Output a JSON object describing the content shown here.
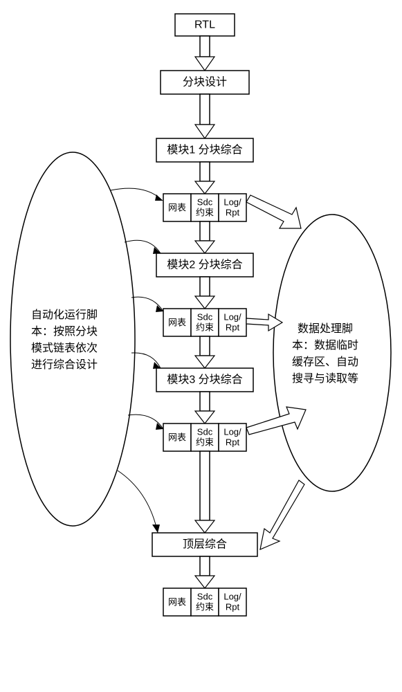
{
  "chart_data": {
    "type": "diagram",
    "title": "",
    "flow_direction": "top-to-bottom",
    "steps": [
      {
        "id": "rtl",
        "label": "RTL"
      },
      {
        "id": "part",
        "label": "分块设计"
      },
      {
        "id": "m1",
        "label": "模块1 分块综合"
      },
      {
        "id": "r1",
        "cells": [
          "网表",
          "Sdc约束",
          "Log/Rpt"
        ]
      },
      {
        "id": "m2",
        "label": "模块2 分块综合"
      },
      {
        "id": "r2",
        "cells": [
          "网表",
          "Sdc约束",
          "Log/Rpt"
        ]
      },
      {
        "id": "m3",
        "label": "模块3 分块综合"
      },
      {
        "id": "r3",
        "cells": [
          "网表",
          "Sdc约束",
          "Log/Rpt"
        ]
      },
      {
        "id": "top",
        "label": "顶层综合"
      },
      {
        "id": "rtop",
        "cells": [
          "网表",
          "Sdc约束",
          "Log/Rpt"
        ]
      }
    ],
    "left_ellipse": "自动化运行脚本：按照分块模式链表依次进行综合设计",
    "right_ellipse": "数据处理脚本：数据临时缓存区、自动搜寻与读取等"
  },
  "nodes": {
    "rtl": "RTL",
    "part": "分块设计",
    "m1": "模块1 分块综合",
    "m2": "模块2 分块综合",
    "m3": "模块3 分块综合",
    "top": "顶层综合"
  },
  "cells": {
    "c0": "网表",
    "c1a": "Sdc",
    "c1b": "约束",
    "c2a": "Log/",
    "c2b": "Rpt"
  },
  "leftText": {
    "l1": "自动化运行脚",
    "l2": "本：按照分块",
    "l3": "模式链表依次",
    "l4": "进行综合设计"
  },
  "rightText": {
    "l1": "数据处理脚",
    "l2": "本：数据临时",
    "l3": "缓存区、自动",
    "l4": "搜寻与读取等"
  }
}
